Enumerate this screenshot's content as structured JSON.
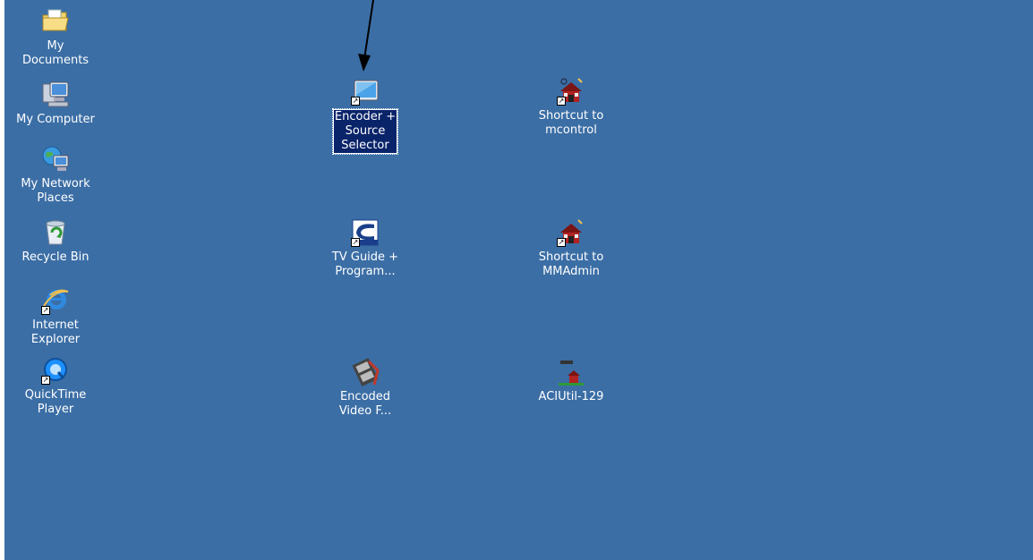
{
  "desktop": {
    "icons": [
      {
        "label": "My\nDocuments",
        "icon": "folder-documents-icon"
      },
      {
        "label": "My Computer",
        "icon": "computer-icon"
      },
      {
        "label": "My Network\nPlaces",
        "icon": "network-places-icon"
      },
      {
        "label": "Recycle Bin",
        "icon": "recycle-bin-icon"
      },
      {
        "label": "Internet\nExplorer",
        "icon": "internet-explorer-icon"
      },
      {
        "label": "QuickTime\nPlayer",
        "icon": "quicktime-icon"
      },
      {
        "label": "Encoder +\nSource\nSelector",
        "icon": "monitor-icon",
        "selected": true
      },
      {
        "label": "TV Guide +\nProgram...",
        "icon": "tv-guide-icon"
      },
      {
        "label": "Encoded\nVideo F...",
        "icon": "video-files-icon"
      },
      {
        "label": "Shortcut to\nmcontrol",
        "icon": "house-icon"
      },
      {
        "label": "Shortcut to\nMMAdmin",
        "icon": "house-icon"
      },
      {
        "label": "ACIUtil-129",
        "icon": "util-house-icon"
      }
    ]
  },
  "colors": {
    "desktop_bg": "#3b6ea5",
    "selection": "#0a246a"
  }
}
